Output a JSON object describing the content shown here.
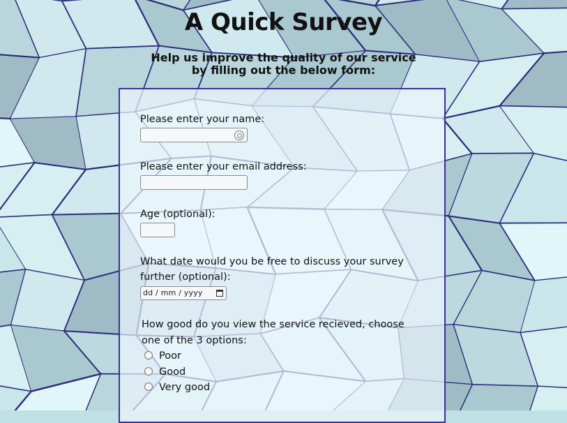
{
  "page": {
    "title": "A Quick Survey",
    "subtitle_line1": "Help us improve the quality of our service",
    "subtitle_line2": "by filling out the below form:"
  },
  "form": {
    "name_label": "Please enter your name:",
    "name_value": "",
    "email_label": "Please enter your email address:",
    "email_value": "",
    "age_label": "Age (optional):",
    "age_value": "",
    "date_label_line1": "What date would you be free to discuss your survey",
    "date_label_line2": "further (optional):",
    "date_placeholder": "dd / mm / yyyy",
    "rating_question_line1": "How good do you view the service recieved, choose",
    "rating_question_line2": "one of the 3 options:",
    "rating_options": [
      "Poor",
      "Good",
      "Very good"
    ]
  },
  "icons": {
    "name_autofill": "contact-autofill-icon",
    "date_picker": "calendar-icon"
  },
  "colors": {
    "panel_border": "#3a2f9b",
    "tile_edge": "#2e2a7a"
  }
}
